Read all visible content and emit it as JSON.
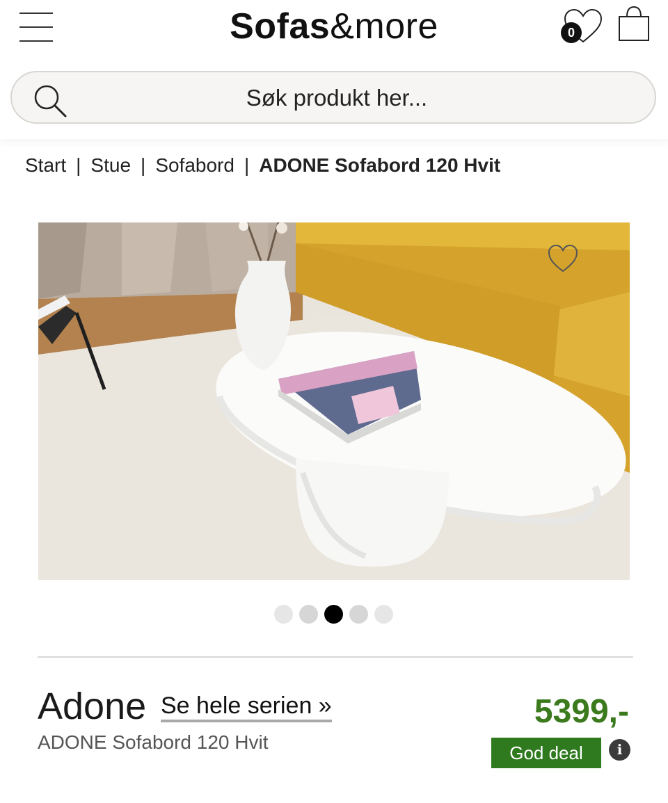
{
  "header": {
    "logo_part1": "Sofas",
    "logo_part2": "&more",
    "wishlist_count": "0",
    "icons": [
      "menu-icon",
      "heart-icon",
      "shopping-bag-icon"
    ]
  },
  "search": {
    "placeholder": "Søk produkt her..."
  },
  "breadcrumb": [
    {
      "label": "Start"
    },
    {
      "label": "Stue"
    },
    {
      "label": "Sofabord"
    },
    {
      "label": "ADONE Sofabord 120 Hvit"
    }
  ],
  "gallery": {
    "slide_count": 5,
    "active_slide": 3
  },
  "product": {
    "brand": "Adone",
    "series_link": "Se hele serien »",
    "name": "ADONE Sofabord 120 Hvit",
    "price": "5399,-",
    "deal_badge": "God deal",
    "info_icon": "i"
  },
  "colors": {
    "price_green": "#3c7a1e",
    "deal_green": "#2f7a1f",
    "sofa_yellow": "#d9aa2e"
  }
}
